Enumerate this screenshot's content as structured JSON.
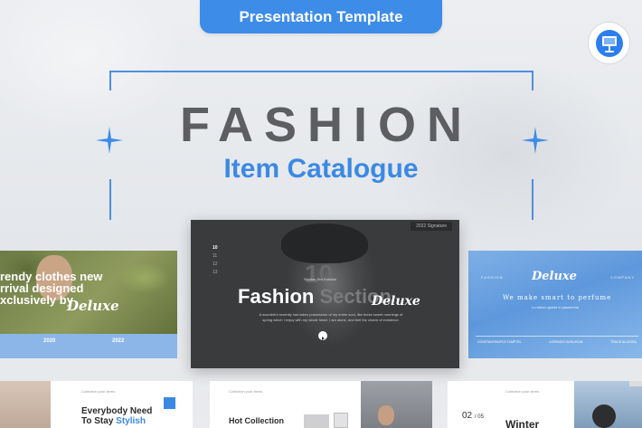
{
  "header": {
    "badge_label": "Presentation Template",
    "app_icon": "keynote-icon"
  },
  "hero": {
    "title": "FASHION",
    "subtitle": "Item Catalogue",
    "decor_icon": "sparkle-star-icon"
  },
  "colors": {
    "accent": "#3d8ce8",
    "title_gray": "#5c5e62",
    "background": "#e9ebee"
  },
  "slides": {
    "center": {
      "signature": "2022 Signature",
      "numbers": [
        "10",
        "11",
        "12",
        "13"
      ],
      "big_number": "10",
      "section_label": "Section Ten Fashion",
      "title_main": "Fashion",
      "title_ghost": "Section",
      "brand": "Deluxe",
      "paragraph": "A wonderful serenity has taken possession of my entire soul, like these sweet mornings of spring which I enjoy with my whole heart. I am alone, and feel the charm of existence.",
      "play_icon": "play-icon"
    },
    "left": {
      "headline": "rendy clothes new\nrrival designed\nxclusively by",
      "brand": "Deluxe",
      "year_1": "2020",
      "year_2": "2022"
    },
    "right": {
      "header_left": "FASHION",
      "header_right": "COMPANY",
      "brand": "Deluxe",
      "tagline": "We make smart to perfume",
      "caption": "Lo sfarzo giusto in passerella",
      "footer": [
        "CONSTANTINOPLE TAMPTEL",
        "LORENZO GUGLIELMI",
        "TRACE ALLEGRA"
      ]
    },
    "bottom_1": {
      "caption": "Collection your items",
      "headline_line1": "Everybody Need",
      "headline_line2": "To Stay",
      "headline_accent": "Stylish"
    },
    "bottom_2": {
      "caption": "Collection your items",
      "headline": "Hot Collection"
    },
    "bottom_3": {
      "number": "02",
      "number_suffix": "/ 05",
      "caption": "Collection your items",
      "headline": "Winter"
    }
  }
}
